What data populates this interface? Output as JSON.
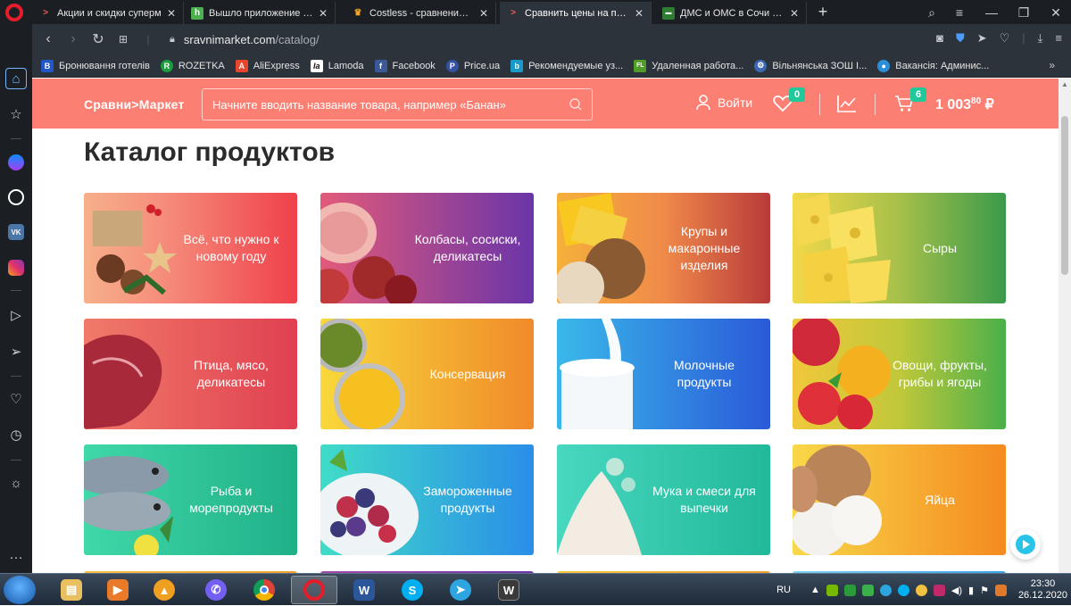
{
  "browser": {
    "tabs": [
      {
        "title": "Акции и скидки суперм",
        "icon": "sravni-icon",
        "color": "#f25c54"
      },
      {
        "title": "Вышло приложение для с",
        "icon": "h-icon",
        "color": "#4caf50"
      },
      {
        "title": "Costless - сравнение цен",
        "icon": "crown-icon",
        "color": "#f5a623"
      },
      {
        "title": "Сравнить цены на продук",
        "icon": "sravni-icon",
        "color": "#f25c54"
      },
      {
        "title": "ДМС и ОМС в Сочи для ч",
        "icon": "ins-icon",
        "color": "#2e7d32"
      }
    ],
    "active_tab": 3,
    "url_host": "sravnimarket.com",
    "url_path": "/catalog/",
    "bookmarks": [
      {
        "label": "Бронювання готелів",
        "glyph": "B",
        "color": "#2157c7"
      },
      {
        "label": "ROZETKA",
        "glyph": "R",
        "color": "#1b9e3e"
      },
      {
        "label": "AliExpress",
        "glyph": "A",
        "color": "#e8462c"
      },
      {
        "label": "Lamoda",
        "glyph": "la",
        "color": "#111111"
      },
      {
        "label": "Facebook",
        "glyph": "f",
        "color": "#3b5998"
      },
      {
        "label": "Price.ua",
        "glyph": "P",
        "color": "#3552a2"
      },
      {
        "label": "Рекомендуемые уз...",
        "glyph": "b",
        "color": "#1a9ac8"
      },
      {
        "label": "Удаленная работа...",
        "glyph": "FL",
        "color": "#4f9c2b"
      },
      {
        "label": "Вільнянська ЗОШ І...",
        "glyph": "⚙",
        "color": "#3b68b5"
      },
      {
        "label": "Вакансія: Админис...",
        "glyph": "●",
        "color": "#2a8fd6"
      }
    ]
  },
  "site": {
    "logo": "Сравни>Маркет",
    "search_placeholder": "Начните вводить название товара, например «Банан»",
    "login_label": "Войти",
    "favorites_count": "0",
    "cart_count": "6",
    "cart_total_main": "1 003",
    "cart_total_kopeks": "80",
    "currency": "₽",
    "accent": "#fb7f73"
  },
  "catalog": {
    "title": "Каталог продуктов",
    "categories": [
      {
        "name": "Всё, что нужно к новому году",
        "from": "#f58a7a",
        "to": "#f0404a"
      },
      {
        "name": "Колбасы, сосиски, деликатесы",
        "from": "#c14a8e",
        "to": "#6a35a8"
      },
      {
        "name": "Крупы и макаронные изделия",
        "from": "#f08a4a",
        "to": "#b83a3a"
      },
      {
        "name": "Сыры",
        "from": "#e6c94a",
        "to": "#3a9a4a"
      },
      {
        "name": "Птица, мясо, деликатесы",
        "from": "#f07a6a",
        "to": "#e04050"
      },
      {
        "name": "Консервация",
        "from": "#f5c93a",
        "to": "#f08a2a"
      },
      {
        "name": "Молочные продукты",
        "from": "#3ab0e8",
        "to": "#2a6ad8"
      },
      {
        "name": "Овощи, фрукты, грибы и ягоды",
        "from": "#f0d03a",
        "to": "#4ab04a"
      },
      {
        "name": "Рыба и морепродукты",
        "from": "#3ad0a8",
        "to": "#20b088"
      },
      {
        "name": "Замороженные продукты",
        "from": "#3ad8c8",
        "to": "#2a90e8"
      },
      {
        "name": "Мука и смеси для выпечки",
        "from": "#40d4b8",
        "to": "#22b89a"
      },
      {
        "name": "Яйца",
        "from": "#f8d040",
        "to": "#f58a20"
      }
    ]
  },
  "taskbar": {
    "apps": [
      "explorer",
      "media-player",
      "aimp",
      "viber",
      "chrome",
      "opera",
      "word",
      "skype",
      "telegram",
      "wot"
    ],
    "active_app": "opera",
    "language": "RU",
    "time": "23:30",
    "date": "26.12.2020"
  }
}
